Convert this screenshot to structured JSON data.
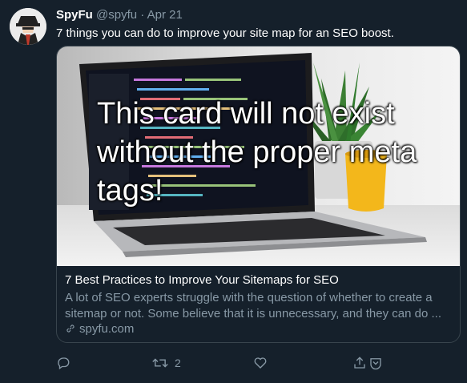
{
  "tweet": {
    "author_name": "SpyFu",
    "author_handle": "@spyfu",
    "separator": "·",
    "date": "Apr 21",
    "text": "7 things you can do to improve your site map for an SEO boost."
  },
  "card": {
    "image_overlay_text": "This card will not exist without the proper meta tags!",
    "title": "7 Best Practices to Improve Your Sitemaps for SEO",
    "description": "A lot of SEO experts struggle with the question of whether to create a sitemap or not. Some believe that it is unnecessary, and they can do ...",
    "domain": "spyfu.com"
  },
  "actions": {
    "reply_icon": "reply-icon",
    "retweet_icon": "retweet-icon",
    "retweet_count": "2",
    "like_icon": "heart-icon",
    "share_icon": "share-icon"
  },
  "colors": {
    "background": "#15202b",
    "border": "#38444d",
    "muted": "#8899a6",
    "text": "#ffffff"
  }
}
